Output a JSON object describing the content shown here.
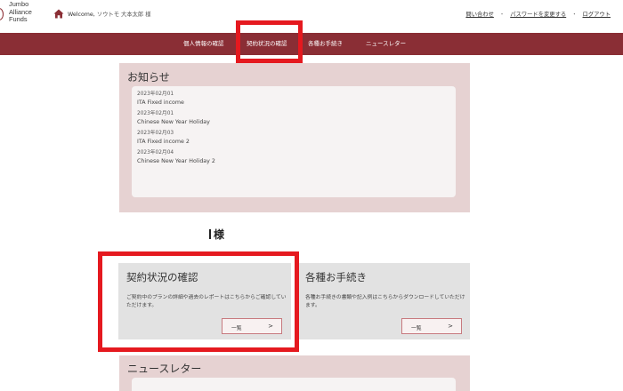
{
  "header": {
    "logo_lines": [
      "Jumbo",
      "Alliance",
      "Funds"
    ],
    "welcome_prefix": "Welcome,",
    "welcome_name": "ソウトモ 大本太郎 様",
    "links": {
      "contact": "問い合わせ",
      "change_password": "パスワードを変更する",
      "logout": "ログアウト",
      "separator": "・"
    }
  },
  "nav": {
    "items": [
      {
        "label": "個人情報の確認"
      },
      {
        "label": "契約状況の確認"
      },
      {
        "label": "各種お手続き"
      },
      {
        "label": "ニュースレター"
      }
    ],
    "highlighted_index": 1,
    "highlight_color": "#e5191f",
    "bar_color": "#8a2e35"
  },
  "notices": {
    "title": "お知らせ",
    "items": [
      {
        "date": "2023年02月01",
        "title": "ITA Fixed income"
      },
      {
        "date": "2023年02月01",
        "title": "Chinese New Year Holiday"
      },
      {
        "date": "2023年02月03",
        "title": "ITA Fixed income 2"
      },
      {
        "date": "2023年02月04",
        "title": "Chinese New Year Holiday 2"
      }
    ]
  },
  "user": {
    "honorific": "様"
  },
  "cards": {
    "contract": {
      "title": "契約状況の確認",
      "description": "ご契約中のプランの詳細や過去のレポートはこちらからご確認していただけます。",
      "button_label": "一覧",
      "button_arrow": ">"
    },
    "procedures": {
      "title": "各種お手続き",
      "description": "各種お手続きの書類や記入例はこちらからダウンロードしていただけます。",
      "button_label": "一覧",
      "button_arrow": ">"
    }
  },
  "newsletter": {
    "title": "ニュースレター"
  },
  "colors": {
    "accent": "#8a2e35",
    "panel_pink": "#e6d2d2",
    "card_grey": "#e2e2e2",
    "annotation_red": "#e5191f"
  },
  "icons": {
    "home": "home-icon",
    "logo": "logo-mark"
  }
}
